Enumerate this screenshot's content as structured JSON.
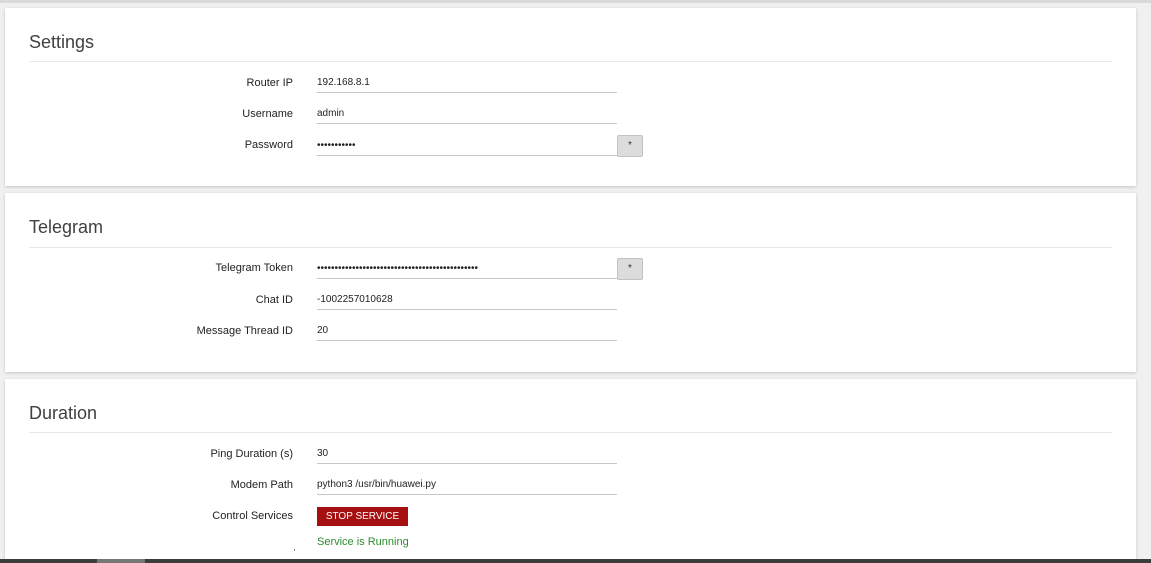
{
  "settings": {
    "title": "Settings",
    "router_ip": {
      "label": "Router IP",
      "value": "192.168.8.1"
    },
    "username": {
      "label": "Username",
      "value": "admin"
    },
    "password": {
      "label": "Password",
      "value": "•••••••••••"
    },
    "reveal_label": "*"
  },
  "telegram": {
    "title": "Telegram",
    "token": {
      "label": "Telegram Token",
      "value": "••••••••••••••••••••••••••••••••••••••••••••••"
    },
    "reveal_label": "*",
    "chat_id": {
      "label": "Chat ID",
      "value": "-1002257010628"
    },
    "thread_id": {
      "label": "Message Thread ID",
      "value": "20"
    }
  },
  "duration": {
    "title": "Duration",
    "ping": {
      "label": "Ping Duration (s)",
      "value": "30"
    },
    "modem_path": {
      "label": "Modem Path",
      "value": "python3 /usr/bin/huawei.py"
    },
    "control": {
      "label": "Control Services",
      "button": "STOP SERVICE"
    },
    "status_text": "Service is Running"
  },
  "colors": {
    "stop_button": "#a50f0f",
    "status_running": "#2e8b2e"
  }
}
